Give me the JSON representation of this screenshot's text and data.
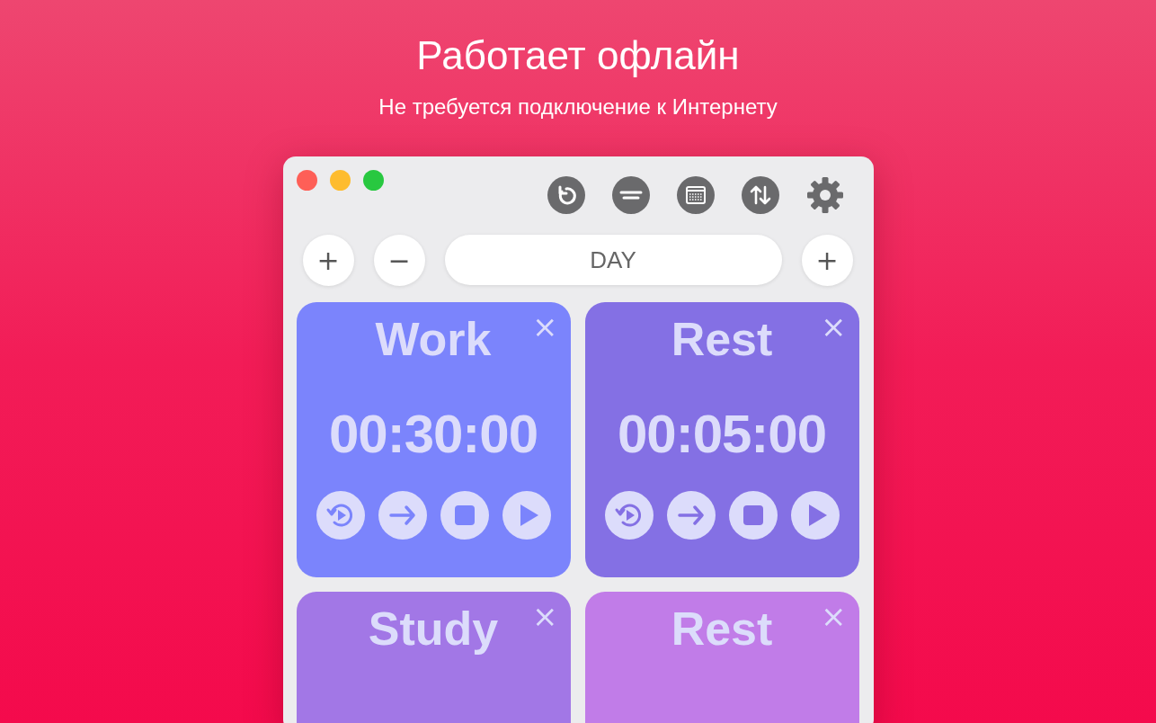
{
  "headline": "Работает офлайн",
  "subtitle": "Не требуется подключение к Интернету",
  "toolbar": {
    "period": "DAY",
    "add_left": "+",
    "remove": "−",
    "add_right": "+"
  },
  "timers": [
    {
      "name": "Work",
      "time": "00:30:00",
      "color": "#7b84fc",
      "close": "×"
    },
    {
      "name": "Rest",
      "time": "00:05:00",
      "color": "#8470e4",
      "close": "×"
    },
    {
      "name": "Study",
      "color": "#a277e6",
      "close": "×"
    },
    {
      "name": "Rest",
      "color": "#c17ce8",
      "close": "×"
    }
  ]
}
